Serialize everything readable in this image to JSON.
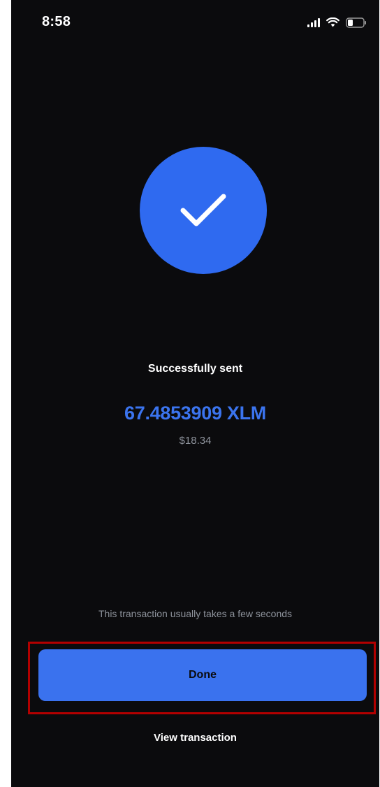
{
  "status_bar": {
    "time": "8:58",
    "icons": [
      "signal-icon",
      "wifi-icon",
      "battery-icon"
    ]
  },
  "success": {
    "icon": "checkmark-icon",
    "title": "Successfully sent",
    "amount": "67.4853909 XLM",
    "fiat_value": "$18.34"
  },
  "footer": {
    "note": "This transaction usually takes a few seconds",
    "done_label": "Done",
    "view_transaction_label": "View transaction"
  },
  "colors": {
    "background": "#0b0b0d",
    "accent": "#3a72ee",
    "highlight_border": "#b30000",
    "muted_text": "#8e939c"
  }
}
